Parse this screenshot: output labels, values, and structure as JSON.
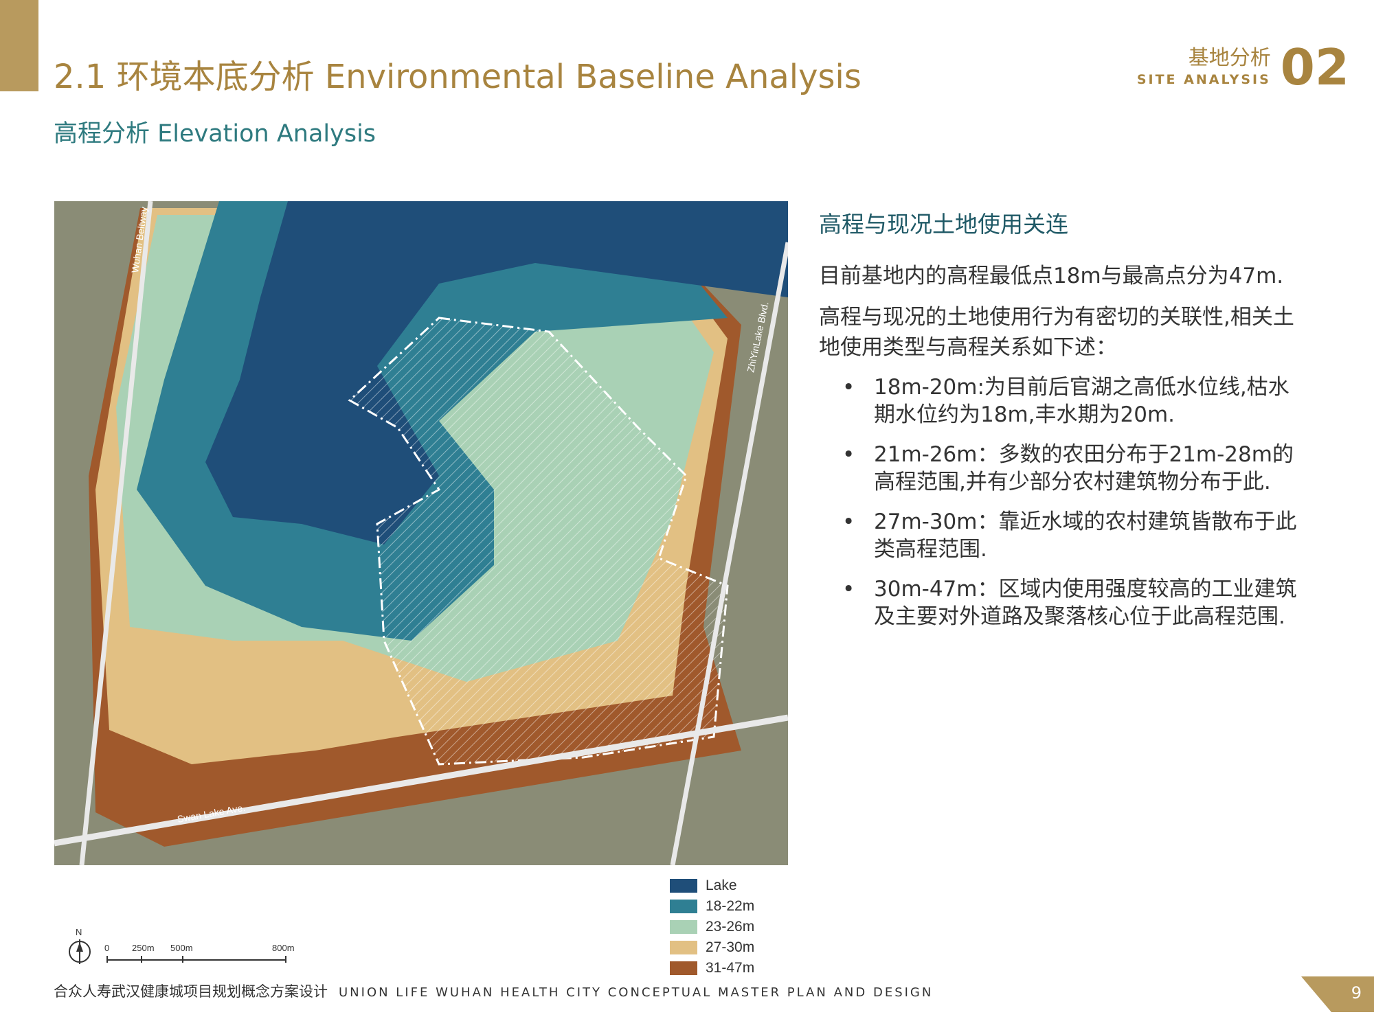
{
  "header": {
    "title": "2.1 环境本底分析 Environmental Baseline Analysis",
    "subtitle": "高程分析 Elevation Analysis",
    "section_cn": "基地分析",
    "section_en": "SITE ANALYSIS",
    "section_num": "02"
  },
  "map": {
    "road_labels": {
      "beltway": "Wuhan Beltway",
      "zhiyin": "ZhiYinLake Blvd.",
      "swan": "Swan Lake Ave."
    },
    "north_label": "N",
    "scale": {
      "ticks": [
        "0",
        "250m",
        "500m",
        "800m"
      ]
    }
  },
  "legend": [
    {
      "label": "Lake",
      "color": "#1f4e79"
    },
    {
      "label": "18-22m",
      "color": "#2f7f93"
    },
    {
      "label": "23-26m",
      "color": "#a9d1b5"
    },
    {
      "label": "27-30m",
      "color": "#e2c083"
    },
    {
      "label": "31-47m",
      "color": "#a0592c"
    }
  ],
  "content": {
    "heading": "高程与现况土地使用关连",
    "para1": "目前基地内的高程最低点18m与最高点分为47m.",
    "para2": "高程与现况的土地使用行为有密切的关联性,相关土地使用类型与高程关系如下述：",
    "bullet_symbol": "•",
    "bullets": [
      "18m-20m:为目前后官湖之高低水位线,枯水期水位约为18m,丰水期为20m.",
      "21m-26m：多数的农田分布于21m-28m的高程范围,并有少部分农村建筑物分布于此.",
      "27m-30m：靠近水域的农村建筑皆散布于此类高程范围.",
      "30m-47m：区域内使用强度较高的工业建筑及主要对外道路及聚落核心位于此高程范围."
    ]
  },
  "footer": {
    "cn": "合众人寿武汉健康城项目规划概念方案设计",
    "en": "UNION LIFE WUHAN HEALTH CITY CONCEPTUAL MASTER PLAN AND DESIGN",
    "page": "9"
  }
}
